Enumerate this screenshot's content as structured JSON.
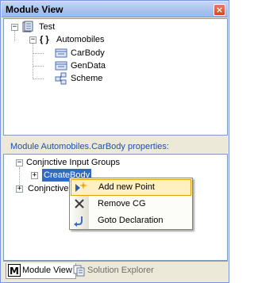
{
  "window": {
    "title": "Module View",
    "close_glyph": "×"
  },
  "tree": {
    "root": {
      "label": "Test",
      "icon": "solution-icon",
      "expander": "−"
    },
    "module": {
      "label": "Automobiles",
      "icon": "braces-namespace-icon",
      "icon_text": "{ }",
      "expander": "−"
    },
    "children": [
      {
        "label": "CarBody",
        "icon": "class-icon"
      },
      {
        "label": "GenData",
        "icon": "class-icon"
      },
      {
        "label": "Scheme",
        "icon": "scheme-icon"
      }
    ]
  },
  "props": {
    "header": "Module Automobiles.CarBody properties:",
    "groups": [
      {
        "label": "Conjnctive Input Groups",
        "expander": "−"
      },
      {
        "label": "CreateBody",
        "expander": "+",
        "selected": true
      },
      {
        "label": "Conjnctive",
        "expander": "+"
      }
    ]
  },
  "context_menu": {
    "items": [
      {
        "label": "Add new Point",
        "icon": "add-point-icon",
        "highlighted": true
      },
      {
        "label": "Remove CG",
        "icon": "delete-x-icon"
      },
      {
        "label": "Goto Declaration",
        "icon": "goto-arrow-icon"
      }
    ]
  },
  "tabs": [
    {
      "label": "Module View",
      "icon": "module-view-icon",
      "active": true
    },
    {
      "label": "Solution Explorer",
      "icon": "solution-explorer-icon",
      "active": false
    }
  ],
  "colors": {
    "selection": "#316ac5",
    "menu_highlight": "#fff0c2",
    "header_text": "#1f4fa8"
  }
}
